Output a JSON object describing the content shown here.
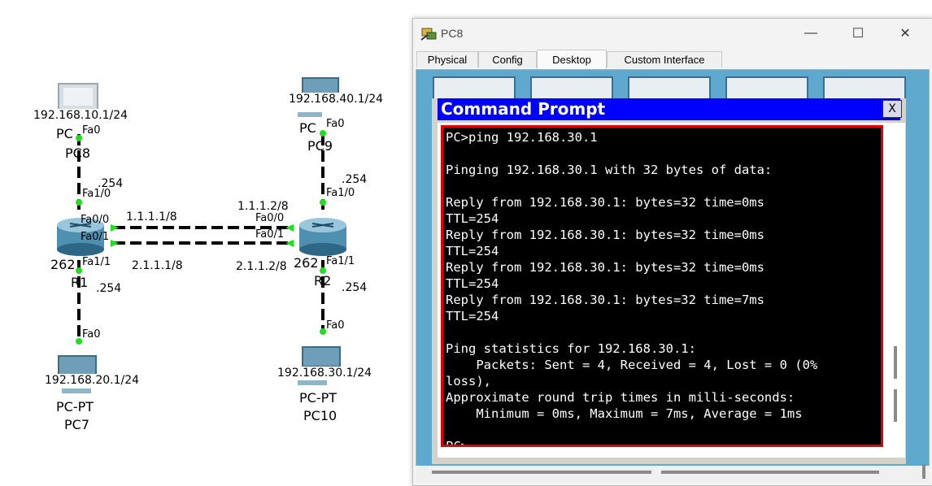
{
  "topology": {
    "devices": [
      {
        "id": "pc8",
        "type_label": "PC",
        "name": "PC8",
        "ip": "192.168.10.1/24",
        "port": "Fa0"
      },
      {
        "id": "pc9",
        "type_label": "PC",
        "name": "PC9",
        "ip": "192.168.40.1/24",
        "port": "Fa0"
      },
      {
        "id": "pc7",
        "type_label": "PC-PT",
        "name": "PC7",
        "ip": "192.168.20.1/24",
        "port": "Fa0"
      },
      {
        "id": "pc10",
        "type_label": "PC-PT",
        "name": "PC10",
        "ip": "192.168.30.1/24",
        "port": "Fa0"
      },
      {
        "id": "r1",
        "type_label": "262",
        "name": "R1"
      },
      {
        "id": "r2",
        "type_label": "262",
        "name": "R2"
      }
    ],
    "labels": {
      "r1_fa10": "Fa1/0",
      "r1_fa00": "Fa0/0",
      "r1_fa01": "Fa0/1",
      "r1_fa11": "Fa1/1",
      "r2_fa10": "Fa1/0",
      "r2_fa00": "Fa0/0",
      "r2_fa01": "Fa0/1",
      "r2_fa11": "Fa1/1",
      "r1_top_host": ".254",
      "r1_bottom_host": ".254",
      "r2_top_host": ".254",
      "r2_bottom_host": ".254",
      "link1_r1": "1.1.1.1/8",
      "link1_r2": "1.1.1.2/8",
      "link2_r1": "2.1.1.1/8",
      "link2_r2": "2.1.1.2/8"
    }
  },
  "window": {
    "title": "PC8",
    "controls": {
      "minimize": "—",
      "maximize": "☐",
      "close": "✕"
    },
    "tabs": [
      {
        "label": "Physical",
        "active": false
      },
      {
        "label": "Config",
        "active": false
      },
      {
        "label": "Desktop",
        "active": true
      },
      {
        "label": "Custom Interface",
        "active": false
      }
    ],
    "command_prompt": {
      "title": "Command Prompt",
      "close_label": "X",
      "lines": [
        "PC>ping 192.168.30.1",
        "",
        "Pinging 192.168.30.1 with 32 bytes of data:",
        "",
        "Reply from 192.168.30.1: bytes=32 time=0ms",
        "TTL=254",
        "Reply from 192.168.30.1: bytes=32 time=0ms",
        "TTL=254",
        "Reply from 192.168.30.1: bytes=32 time=0ms",
        "TTL=254",
        "Reply from 192.168.30.1: bytes=32 time=7ms",
        "TTL=254",
        "",
        "Ping statistics for 192.168.30.1:",
        "    Packets: Sent = 4, Received = 4, Lost = 0 (0%",
        "loss),",
        "Approximate round trip times in milli-seconds:",
        "    Minimum = 0ms, Maximum = 7ms, Average = 1ms",
        "",
        "PC>"
      ]
    }
  },
  "colors": {
    "link_up": "#22dd22",
    "prompt_title": "#0000ff",
    "terminal_border": "#e00000",
    "desktop_bg": "#5fa9ce"
  }
}
